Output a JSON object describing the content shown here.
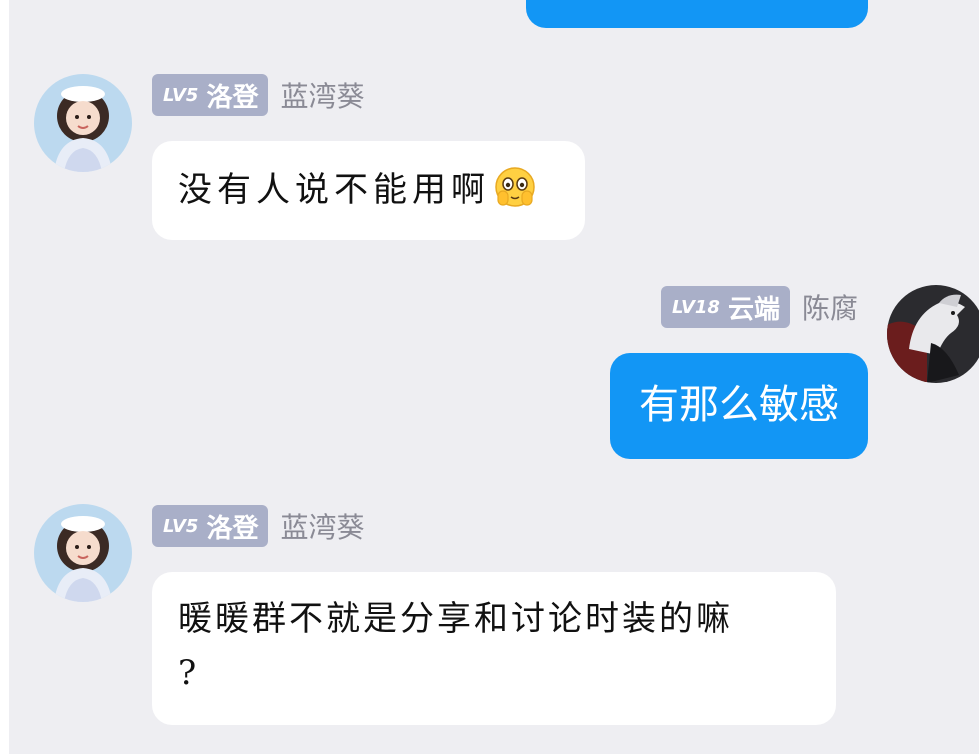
{
  "colors": {
    "background": "#eeeef2",
    "outgoing_bubble": "#1296f5",
    "incoming_bubble": "#ffffff",
    "badge": "#a9afc8",
    "nickname": "#8a8a95"
  },
  "messages": [
    {
      "direction": "in",
      "level": "LV5",
      "title": "洛登",
      "nickname": "蓝湾葵",
      "text": "没有人说不能用啊",
      "emoji": "peeking-face-emoji",
      "avatar": "girl-avatar"
    },
    {
      "direction": "out",
      "level": "LV18",
      "title": "云端",
      "nickname": "陈腐",
      "text": "有那么敏感",
      "avatar": "white-horse-avatar"
    },
    {
      "direction": "in",
      "level": "LV5",
      "title": "洛登",
      "nickname": "蓝湾葵",
      "text_line1": "暖暖群不就是分享和讨论时装的嘛",
      "text_line2": "?",
      "avatar": "girl-avatar"
    }
  ]
}
